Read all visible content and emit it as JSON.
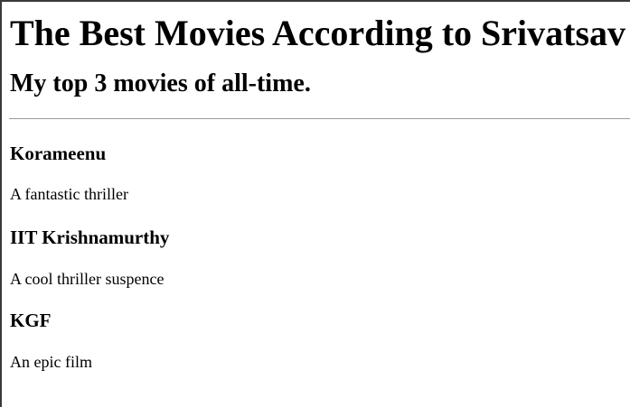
{
  "page": {
    "title": "The Best Movies According to Srivatsav",
    "subtitle": "My top 3 movies of all-time."
  },
  "movies": [
    {
      "title": "Korameenu",
      "description": "A fantastic thriller"
    },
    {
      "title": "IIT Krishnamurthy",
      "description": "A cool thriller suspence"
    },
    {
      "title": "KGF",
      "description": "An epic film"
    }
  ]
}
